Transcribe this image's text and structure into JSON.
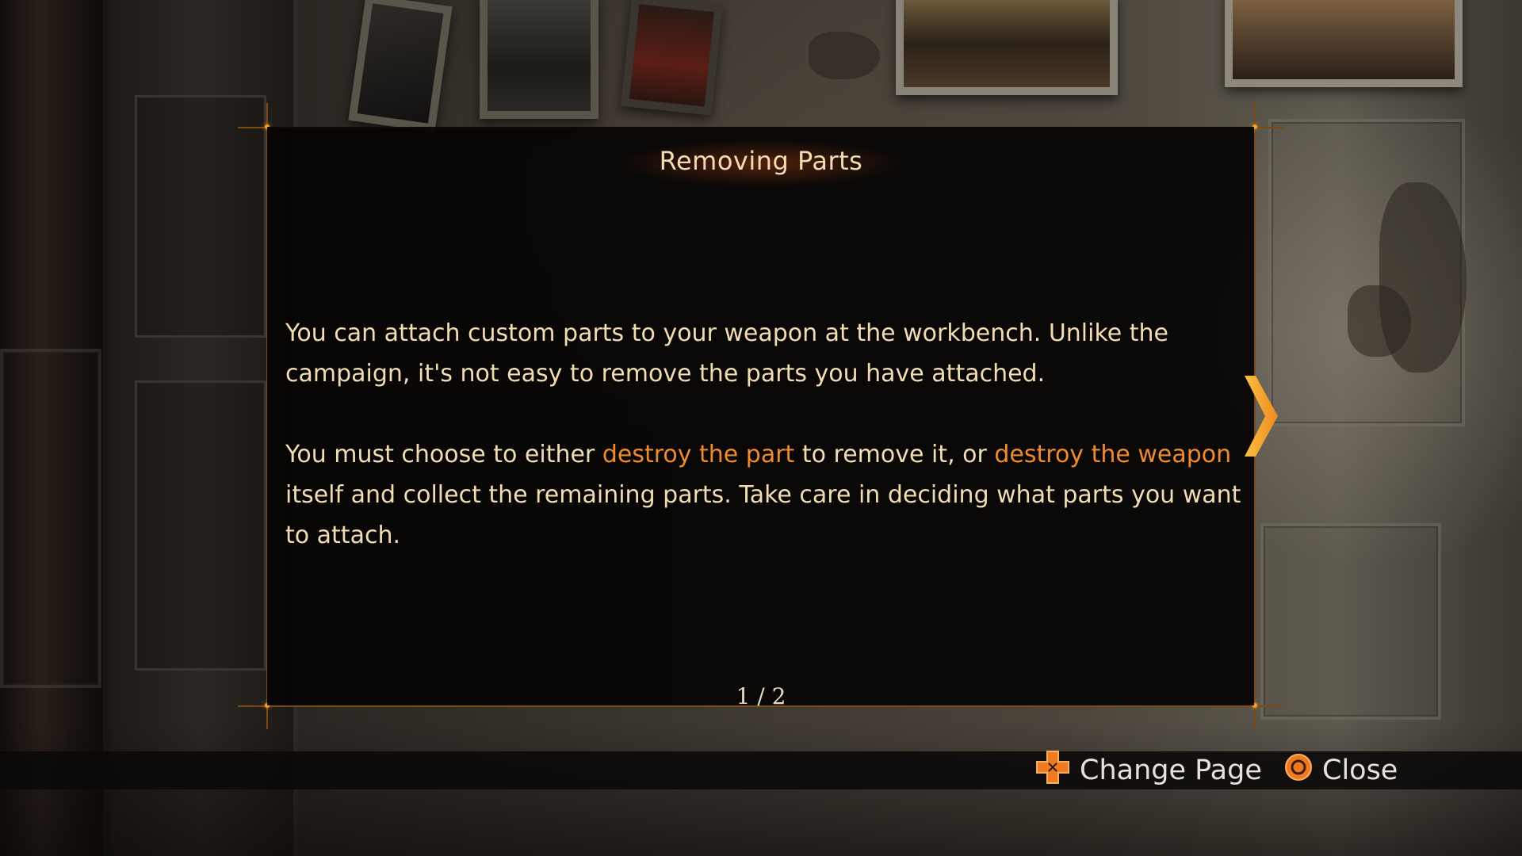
{
  "dialog": {
    "title": "Removing Parts",
    "paragraph1": "You can attach custom parts to your weapon at the workbench. Unlike the campaign, it's not easy to remove the parts you have attached.",
    "paragraph2": {
      "t1": "You must choose to either ",
      "h1": "destroy the part",
      "t2": " to remove it, or ",
      "h2": "destroy the weapon",
      "t3": " itself and collect the remaining parts. Take care in deciding what parts you want to attach."
    },
    "page_indicator": "1 / 2",
    "next_icon": "chevron-right-icon"
  },
  "prompts": {
    "change_page": {
      "icon": "dpad-icon",
      "label": "Change Page"
    },
    "close": {
      "icon": "circle-button-icon",
      "label": "Close"
    }
  },
  "colors": {
    "text": "#f1dcb3",
    "highlight": "#f08a2e",
    "accent": "#f5a623",
    "panel": "#050403"
  }
}
